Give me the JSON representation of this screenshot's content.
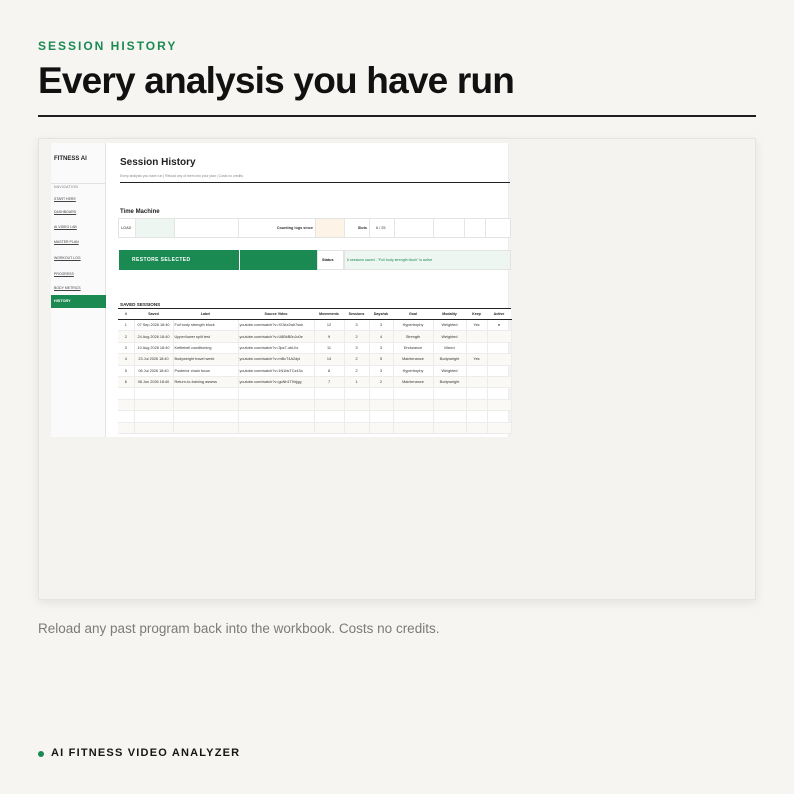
{
  "page": {
    "eyebrow": "SESSION HISTORY",
    "headline": "Every analysis you have run",
    "caption": "Reload any past program back into the workbook. Costs no credits.",
    "footer": "AI FITNESS VIDEO ANALYZER",
    "colors": {
      "accent": "#1a8a52",
      "text": "#111111",
      "background": "#f6f5f1"
    }
  },
  "sheet": {
    "brand": "FITNESS AI",
    "nav_heading": "NAVIGATION",
    "nav": [
      {
        "label": "START HERE"
      },
      {
        "label": "DASHBOARD"
      },
      {
        "label": "AI VIDEO LAB"
      },
      {
        "label": "MASTER PLAN"
      },
      {
        "label": "WORKOUT LOG"
      },
      {
        "label": "PROGRESS"
      },
      {
        "label": "BODY METRICS"
      },
      {
        "label": "HISTORY",
        "active": true
      }
    ],
    "title": "Session History",
    "subtitle": "Every analysis you have run  |  Reload any of them into your plan  |  Costs no credits",
    "time_machine": {
      "title": "Time Machine",
      "load_label": "LOAD",
      "counting_label": "Counting logs since",
      "slots_label": "Slots",
      "slots_value": "6 / 25"
    },
    "restore_label": "RESTORE SELECTED",
    "status_label": "Status",
    "status_value": "6 sessions saved - \"Full body strength block\" is active",
    "saved_title": "SAVED SESSIONS",
    "columns": [
      "#",
      "Saved",
      "Label",
      "Source Video",
      "Movements",
      "Sessions",
      "Days/wk",
      "Goal",
      "Modality",
      "Keep",
      "Active"
    ],
    "rows": [
      {
        "n": "1",
        "saved": "07 Sep 2026 18:40",
        "label": "Full body strength block",
        "source": "youtube.com/watch?v=XOAx2wk7snk",
        "movements": "12",
        "sessions": "3",
        "days": "3",
        "goal": "Hypertrophy",
        "modality": "Weighted",
        "keep": "Yes",
        "active": "●"
      },
      {
        "n": "2",
        "saved": "24 Aug 2026 18:40",
        "label": "Upper/lower split test",
        "source": "youtube.com/watch?v=U8BkB0nJo0e",
        "movements": "9",
        "sessions": "2",
        "days": "4",
        "goal": "Strength",
        "modality": "Weighted",
        "keep": "",
        "active": ""
      },
      {
        "n": "3",
        "saved": "10 Aug 2026 18:40",
        "label": "Kettlebell conditioning",
        "source": "youtube.com/watch?v=3ps7-obLIIx",
        "movements": "11",
        "sessions": "3",
        "days": "3",
        "goal": "Endurance",
        "modality": "Mixed",
        "keep": "",
        "active": ""
      },
      {
        "n": "4",
        "saved": "23 Jul 2026 18:40",
        "label": "Bodyweight travel week",
        "source": "youtube.com/watch?v=mBcT4A2dpl",
        "movements": "14",
        "sessions": "2",
        "days": "5",
        "goal": "Maintenance",
        "modality": "Bodyweight",
        "keep": "Yes",
        "active": ""
      },
      {
        "n": "5",
        "saved": "06 Jul 2026 18:40",
        "label": "Posterior chain focus",
        "source": "youtube.com/watch?v=1N1bkTCz43o",
        "movements": "8",
        "sessions": "2",
        "days": "3",
        "goal": "Hypertrophy",
        "modality": "Weighted",
        "keep": "",
        "active": ""
      },
      {
        "n": "6",
        "saved": "08 Jun 2026 18:40",
        "label": "Return-to-training assess",
        "source": "youtube.com/watch?v=goNh1TKkjgg",
        "movements": "7",
        "sessions": "1",
        "days": "2",
        "goal": "Maintenance",
        "modality": "Bodyweight",
        "keep": "",
        "active": ""
      }
    ]
  }
}
